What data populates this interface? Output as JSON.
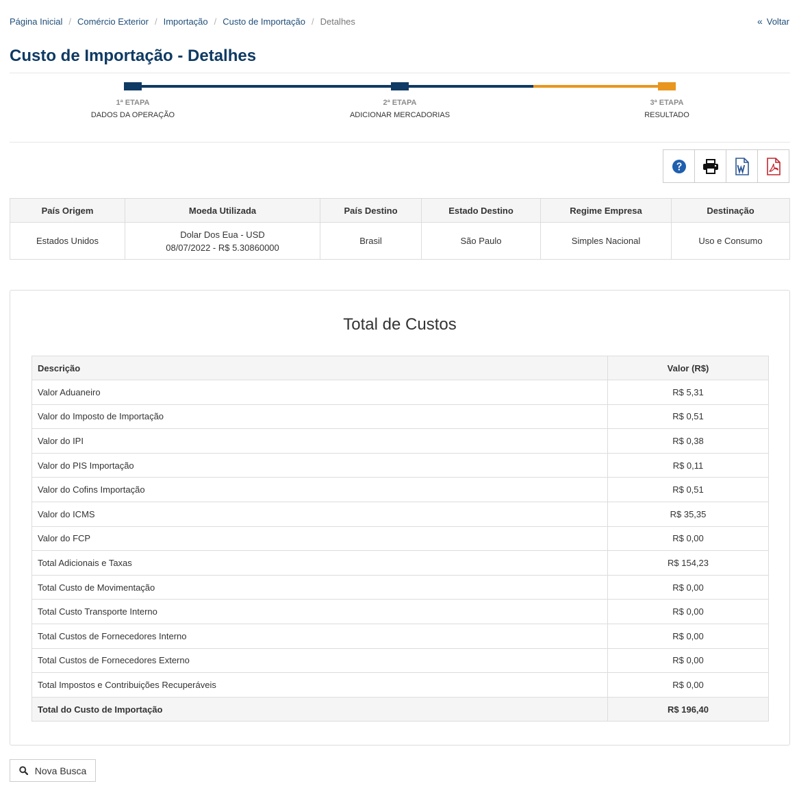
{
  "breadcrumb": {
    "items": [
      "Página Inicial",
      "Comércio Exterior",
      "Importação",
      "Custo de Importação"
    ],
    "current": "Detalhes"
  },
  "back_label": "Voltar",
  "page_title": "Custo de Importação - Detalhes",
  "stepper": {
    "steps": [
      {
        "num": "1ª ETAPA",
        "name": "DADOS DA OPERAÇÃO"
      },
      {
        "num": "2ª ETAPA",
        "name": "ADICIONAR MERCADORIAS"
      },
      {
        "num": "3ª ETAPA",
        "name": "RESULTADO"
      }
    ],
    "colors": {
      "done": "#0f3a63",
      "active": "#e8961e"
    }
  },
  "toolbar": {
    "icons": [
      "help-icon",
      "print-icon",
      "word-icon",
      "pdf-icon"
    ],
    "colors": {
      "help": "#1f5fae",
      "word": "#2b5797",
      "pdf": "#c0272d"
    }
  },
  "info_table": {
    "headers": [
      "País Origem",
      "Moeda Utilizada",
      "País Destino",
      "Estado Destino",
      "Regime Empresa",
      "Destinação"
    ],
    "row": {
      "pais_origem": "Estados Unidos",
      "moeda_line1": "Dolar Dos Eua - USD",
      "moeda_line2": "08/07/2022 - R$ 5.30860000",
      "pais_destino": "Brasil",
      "estado_destino": "São Paulo",
      "regime_empresa": "Simples Nacional",
      "destinacao": "Uso e Consumo"
    }
  },
  "costs": {
    "title": "Total de Custos",
    "headers": {
      "descricao": "Descrição",
      "valor": "Valor (R$)"
    },
    "rows": [
      {
        "label": "Valor Aduaneiro",
        "value": "R$ 5,31"
      },
      {
        "label": "Valor do Imposto de Importação",
        "value": "R$ 0,51"
      },
      {
        "label": "Valor do IPI",
        "value": "R$ 0,38"
      },
      {
        "label": "Valor do PIS Importação",
        "value": "R$ 0,11"
      },
      {
        "label": "Valor do Cofins Importação",
        "value": "R$ 0,51"
      },
      {
        "label": "Valor do ICMS",
        "value": "R$ 35,35"
      },
      {
        "label": "Valor do FCP",
        "value": "R$ 0,00"
      },
      {
        "label": "Total Adicionais e Taxas",
        "value": "R$ 154,23"
      },
      {
        "label": "Total Custo de Movimentação",
        "value": "R$ 0,00"
      },
      {
        "label": "Total Custo Transporte Interno",
        "value": "R$ 0,00"
      },
      {
        "label": "Total Custos de Fornecedores Interno",
        "value": "R$ 0,00"
      },
      {
        "label": "Total Custos de Fornecedores Externo",
        "value": "R$ 0,00"
      },
      {
        "label": "Total Impostos e Contribuições Recuperáveis",
        "value": "R$ 0,00"
      }
    ],
    "total": {
      "label": "Total do Custo de Importação",
      "value": "R$ 196,40"
    }
  },
  "search_button_label": "Nova Busca"
}
